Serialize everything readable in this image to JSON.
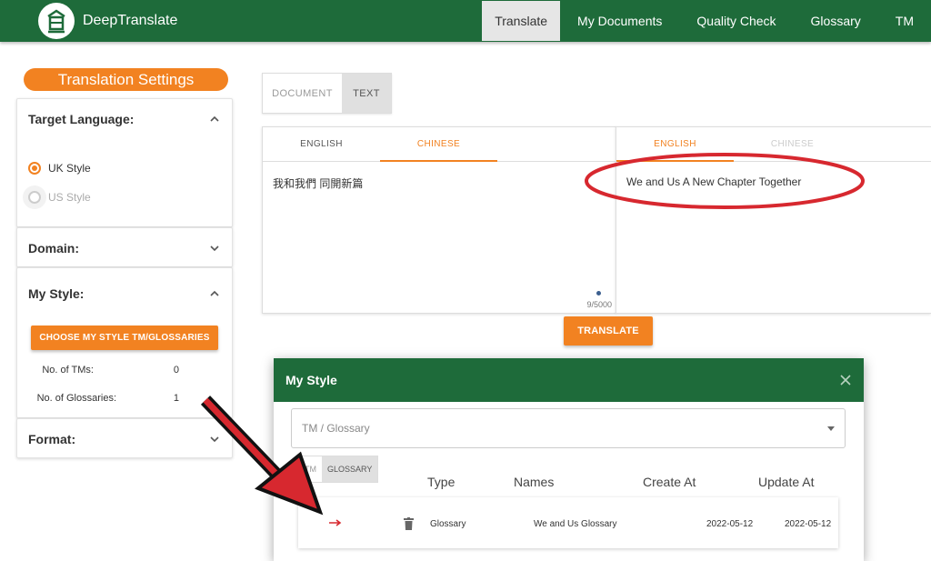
{
  "app": {
    "name": "DeepTranslate"
  },
  "nav": {
    "items": [
      "Translate",
      "My Documents",
      "Quality Check",
      "Glossary",
      "TM"
    ],
    "active": "Translate"
  },
  "sidebar": {
    "title": "Translation Settings",
    "target_language": {
      "label": "Target Language:",
      "options": [
        "UK Style",
        "US Style"
      ],
      "selected": "UK Style"
    },
    "domain": {
      "label": "Domain:"
    },
    "my_style": {
      "label": "My Style:",
      "button": "CHOOSE MY STYLE TM/GLOSSARIES",
      "tms_label": "No. of TMs:",
      "tms_value": "0",
      "glossaries_label": "No. of Glossaries:",
      "glossaries_value": "1"
    },
    "format": {
      "label": "Format:"
    }
  },
  "main": {
    "modes": [
      "DOCUMENT",
      "TEXT"
    ],
    "active_mode": "TEXT",
    "source": {
      "tabs": [
        "ENGLISH",
        "CHINESE"
      ],
      "active": "CHINESE",
      "text": "我和我們 同開新篇",
      "counter": "9/5000"
    },
    "target": {
      "tabs": [
        "ENGLISH",
        "CHINESE"
      ],
      "active": "ENGLISH",
      "text": "We and Us A New Chapter Together"
    },
    "translate_button": "TRANSLATE"
  },
  "modal": {
    "title": "My Style",
    "select_placeholder": "TM / Glossary",
    "toggle": [
      "TM",
      "GLOSSARY"
    ],
    "toggle_active": "GLOSSARY",
    "columns": [
      "Type",
      "Names",
      "Create At",
      "Update At"
    ],
    "rows": [
      {
        "type": "Glossary",
        "name": "We and Us Glossary",
        "created": "2022-05-12",
        "updated": "2022-05-12"
      }
    ]
  },
  "colors": {
    "brand_green": "#1e6b3a",
    "accent_orange": "#f28221",
    "annotation_red": "#d7282f"
  },
  "icons": [
    "logo-icon",
    "chevron-up-icon",
    "chevron-down-icon",
    "close-icon",
    "caret-down-icon",
    "arrow-right-icon",
    "trash-icon"
  ]
}
